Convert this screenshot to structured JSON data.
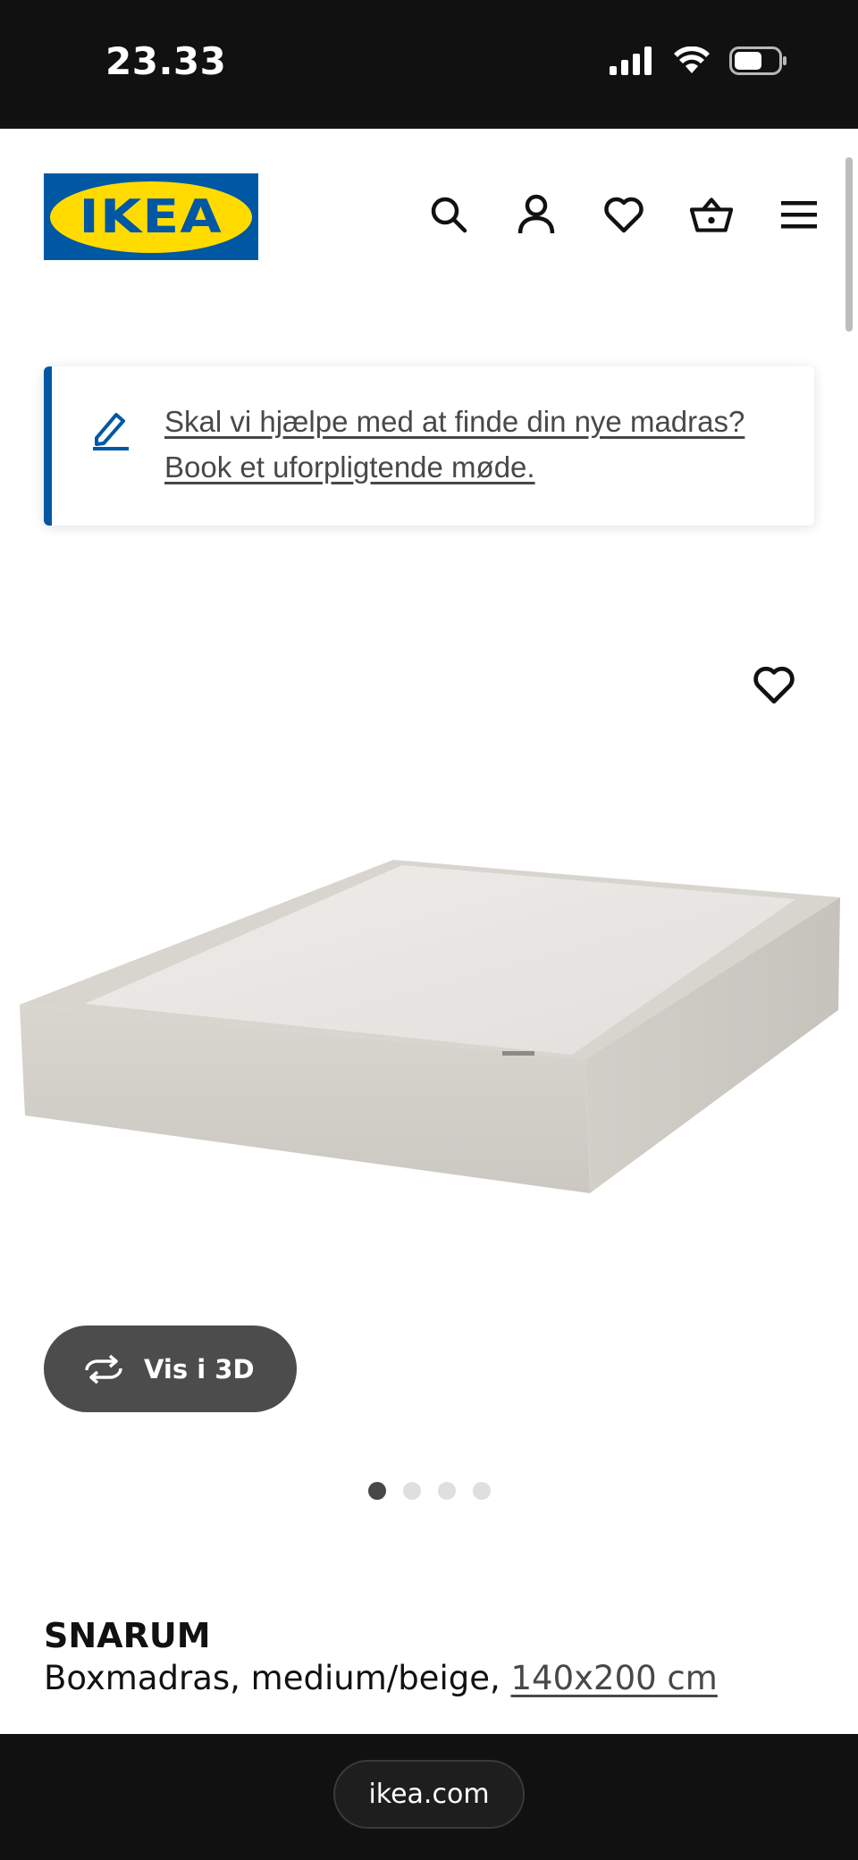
{
  "status_bar": {
    "time": "23.33",
    "icons": [
      "cellular-signal-icon",
      "wifi-icon",
      "battery-icon"
    ]
  },
  "header": {
    "logo_text": "IKEA",
    "nav_icons": [
      "search-icon",
      "account-icon",
      "heart-icon",
      "basket-icon",
      "menu-icon"
    ]
  },
  "banner": {
    "icon": "pencil-icon",
    "text": "Skal vi hjælpe med at finde din nye madras? Book et uforpligtende møde."
  },
  "product": {
    "favorite_icon": "heart-icon",
    "view_3d_label": "Vis i 3D",
    "view_3d_icon": "rotate-icon",
    "carousel": {
      "total": 4,
      "active_index": 0
    },
    "name": "SNARUM",
    "description": "Boxmadras, medium/beige,",
    "size": "140x200 cm"
  },
  "browser": {
    "url": "ikea.com"
  },
  "colors": {
    "ikea_blue": "#0058a3",
    "ikea_yellow": "#ffdb00",
    "dark": "#111111",
    "button_grey": "#4c4c4c",
    "mattress_beige": "#dcd9d3"
  }
}
